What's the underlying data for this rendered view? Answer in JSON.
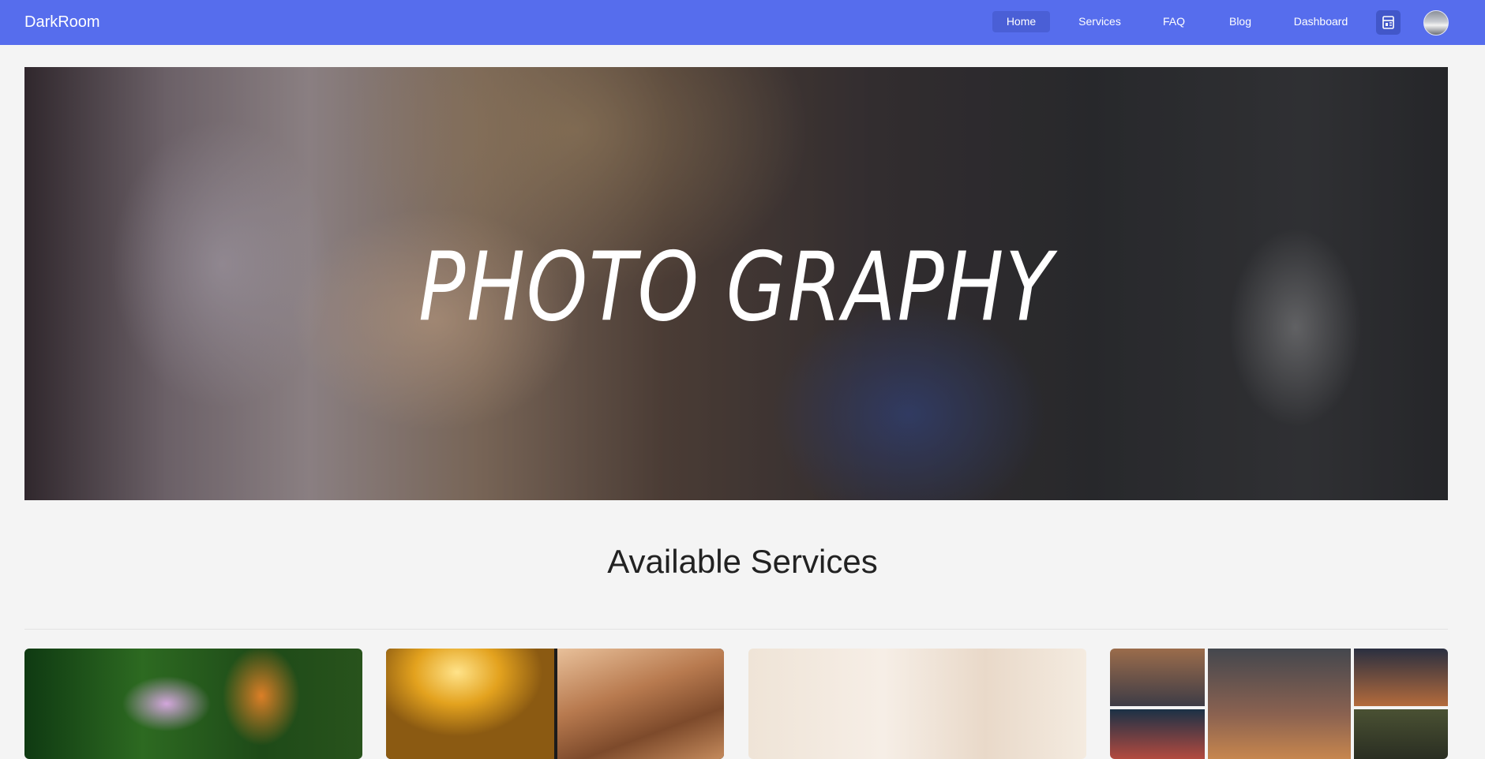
{
  "navbar": {
    "brand": "DarkRoom",
    "links": [
      {
        "label": "Home",
        "active": true
      },
      {
        "label": "Services",
        "active": false
      },
      {
        "label": "FAQ",
        "active": false
      },
      {
        "label": "Blog",
        "active": false
      },
      {
        "label": "Dashboard",
        "active": false
      }
    ],
    "icon_button": "store-icon",
    "avatar": "user-avatar"
  },
  "hero": {
    "title": "PHOTO GRAPHY"
  },
  "services": {
    "heading": "Available Services",
    "cards": [
      {
        "image": "butterfly-on-flower"
      },
      {
        "image": "aerial-city-and-forest"
      },
      {
        "image": "baby-photoshoot-collage"
      },
      {
        "image": "street-photography-collage"
      }
    ]
  },
  "colors": {
    "navbar": "#566ded",
    "nav_active": "#4a5fd6",
    "page_bg": "#f4f4f4"
  }
}
